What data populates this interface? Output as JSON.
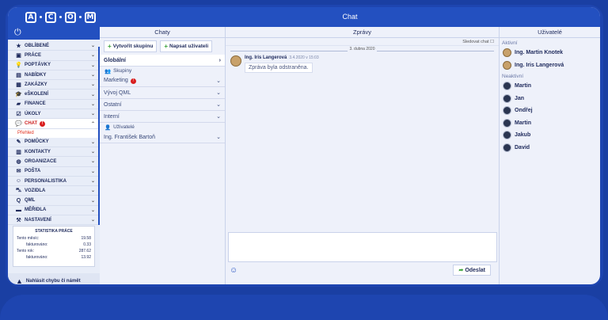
{
  "logo": {
    "letters": [
      "A",
      "C",
      "O",
      "M"
    ]
  },
  "sidebar": {
    "items": [
      {
        "icon": "star-icon",
        "glyph": "★",
        "label": "OBLÍBENÉ"
      },
      {
        "icon": "briefcase-icon",
        "glyph": "▣",
        "label": "PRÁCE"
      },
      {
        "icon": "lightbulb-icon",
        "glyph": "💡",
        "label": "POPTÁVKY"
      },
      {
        "icon": "document-icon",
        "glyph": "▤",
        "label": "NABÍDKY"
      },
      {
        "icon": "box-icon",
        "glyph": "▦",
        "label": "ZAKÁZKY"
      },
      {
        "icon": "graduation-cap-icon",
        "glyph": "🎓",
        "label": "eŠKOLENÍ"
      },
      {
        "icon": "money-icon",
        "glyph": "▰",
        "label": "FINANCE"
      },
      {
        "icon": "checklist-icon",
        "glyph": "☑",
        "label": "ÚKOLY"
      }
    ],
    "chat_item": {
      "label": "CHAT",
      "badge": "!",
      "sub_label": "Přehled"
    },
    "items2": [
      {
        "icon": "tools-icon",
        "glyph": "✎",
        "label": "POMŮCKY"
      },
      {
        "icon": "contacts-icon",
        "glyph": "▥",
        "label": "KONTAKTY"
      },
      {
        "icon": "globe-icon",
        "glyph": "◍",
        "label": "ORGANIZACE"
      },
      {
        "icon": "mail-icon",
        "glyph": "✉",
        "label": "POŠTA"
      },
      {
        "icon": "people-icon",
        "glyph": "☺",
        "label": "PERSONALISTIKA"
      },
      {
        "icon": "car-icon",
        "glyph": "⛍",
        "label": "VOZIDLA"
      },
      {
        "icon": "qml-icon",
        "glyph": "Q",
        "label": "QML"
      },
      {
        "icon": "ruler-icon",
        "glyph": "▬",
        "label": "MĚŘIDLA"
      },
      {
        "icon": "settings-tools-icon",
        "glyph": "⚒",
        "label": "NASTAVENÍ"
      }
    ],
    "stats": {
      "title": "STATISTIKA PRÁCE",
      "rows": [
        {
          "label": "Tento měsíc:",
          "value": "19.58"
        },
        {
          "label": "fakturováno:",
          "value": "0.33"
        },
        {
          "label": "Tento rok:",
          "value": "287.62"
        },
        {
          "label": "fakturováno:",
          "value": "13.92"
        }
      ]
    },
    "report": "Nahlásit chybu či námět"
  },
  "topbar": {
    "title": "Chat"
  },
  "chaty": {
    "header": "Chaty",
    "btn_group": "Vytvořit skupinu",
    "btn_user": "Napsat uživateli",
    "global": "Globální",
    "groups_label": "Skupiny",
    "groups": [
      {
        "label": "Marketing",
        "badge": "!"
      },
      {
        "label": "Vývoj QML",
        "badge": ""
      },
      {
        "label": "Ostatní",
        "badge": ""
      },
      {
        "label": "Interní",
        "badge": ""
      }
    ],
    "users_label": "Uživatelé",
    "user_chats": [
      "Ing. František Bartoň"
    ]
  },
  "zpravy": {
    "header": "Zprávy",
    "follow": "Sledovat chat",
    "date": "3. dubna 2020",
    "message": {
      "author": "Ing. Iris Langerová",
      "time": "3.4.2020 v 15:03",
      "text": "Zpráva byla odstraněna."
    },
    "send": "Odeslat"
  },
  "users": {
    "header": "Uživatelé",
    "active_label": "Aktivní",
    "active": [
      "Ing. Martin Knotek",
      "Ing. Iris Langerová"
    ],
    "inactive_label": "Neaktivní",
    "inactive": [
      "Martin",
      "Jan",
      "Ondřej",
      "Martin",
      "Jakub",
      "David"
    ]
  },
  "colors": {
    "primary": "#2350c0",
    "accent_red": "#d91e1e",
    "accent_green": "#3aa33a",
    "background": "#eef1fa"
  }
}
